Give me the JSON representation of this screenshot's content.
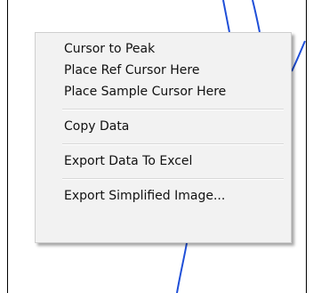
{
  "colors": {
    "trace": "#1f4fd8",
    "menu_background": "#f2f2f2",
    "menu_border": "#cfcfcf",
    "menu_text": "#111111"
  },
  "context_menu": {
    "groups": [
      {
        "items": [
          {
            "label": "Cursor to Peak"
          },
          {
            "label": "Place Ref Cursor Here"
          },
          {
            "label": "Place Sample Cursor Here"
          }
        ]
      },
      {
        "items": [
          {
            "label": "Copy Data"
          }
        ]
      },
      {
        "items": [
          {
            "label": "Export Data To Excel"
          }
        ]
      },
      {
        "items": [
          {
            "label": "Export Simplified Image..."
          }
        ]
      }
    ]
  }
}
